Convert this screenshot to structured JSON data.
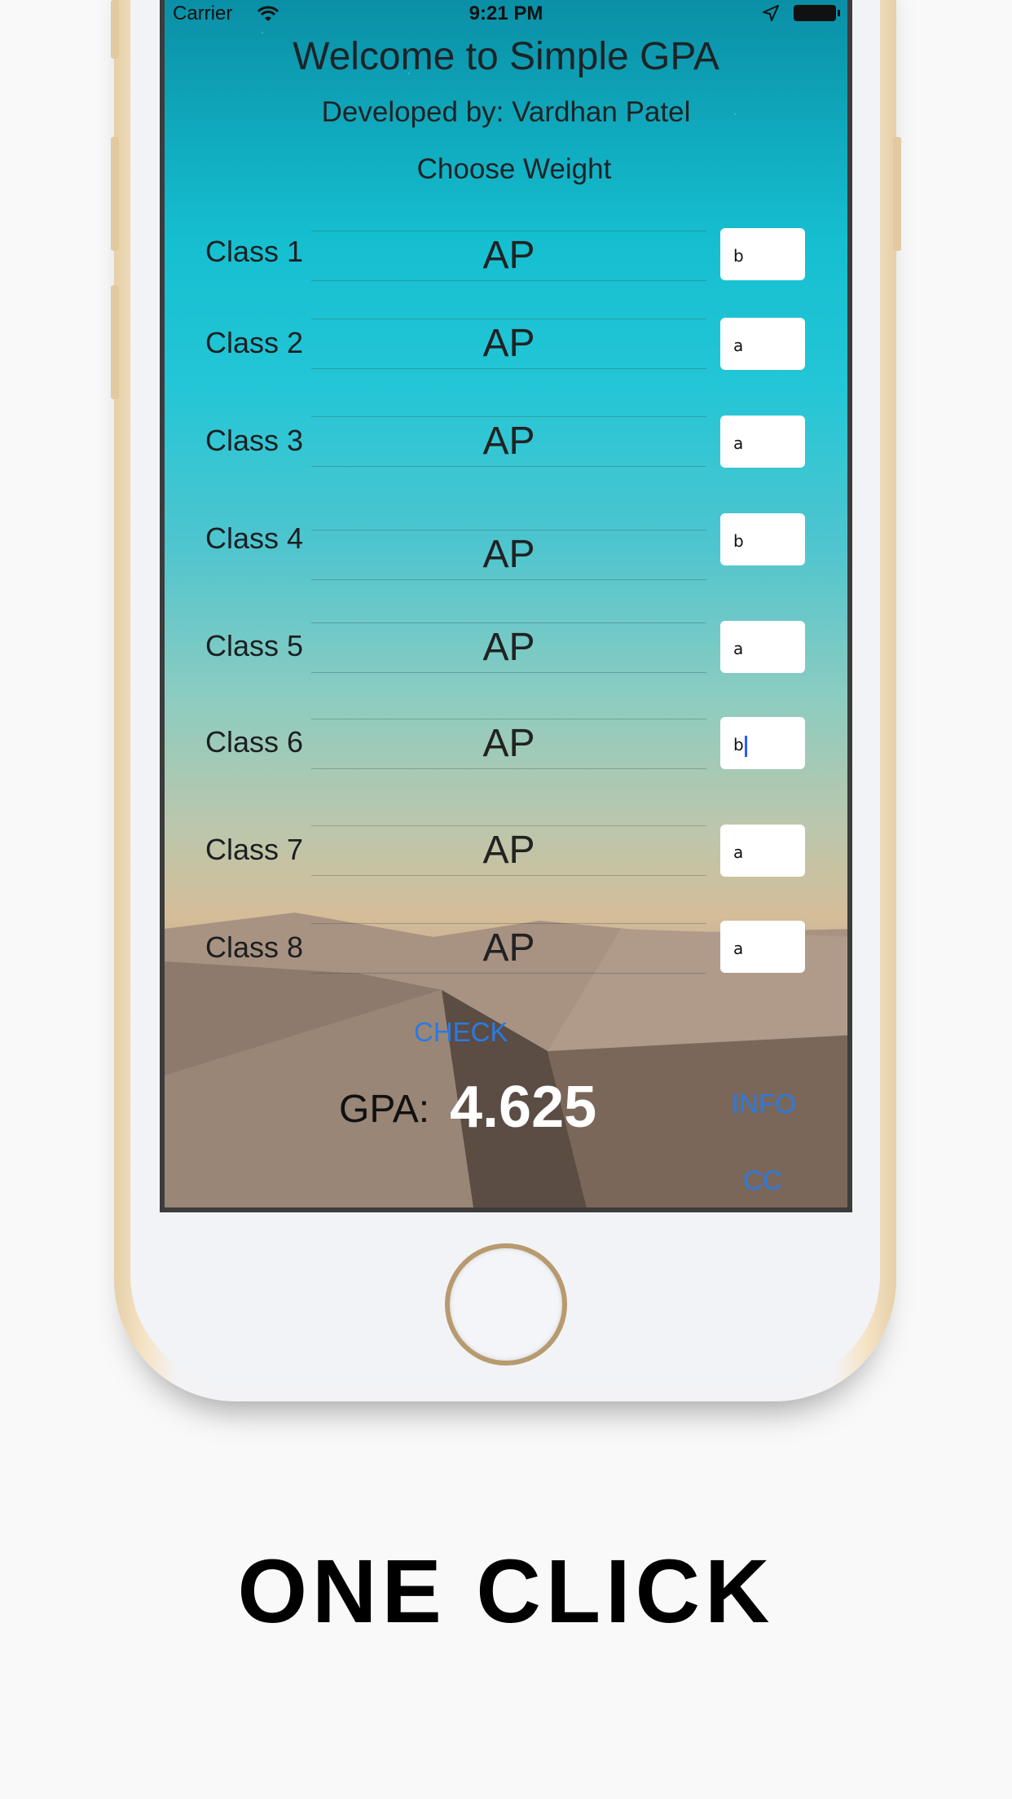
{
  "status_bar": {
    "carrier": "Carrier",
    "time": "9:21 PM"
  },
  "app": {
    "title": "Welcome to Simple GPA",
    "subtitle": "Developed by: Vardhan Patel",
    "weight_prompt": "Choose Weight"
  },
  "classes": [
    {
      "label": "Class 1",
      "weight": "AP",
      "grade": "b"
    },
    {
      "label": "Class 2",
      "weight": "AP",
      "grade": "a"
    },
    {
      "label": "Class 3",
      "weight": "AP",
      "grade": "a"
    },
    {
      "label": "Class 4",
      "weight": "AP",
      "grade": "b"
    },
    {
      "label": "Class 5",
      "weight": "AP",
      "grade": "a"
    },
    {
      "label": "Class 6",
      "weight": "AP",
      "grade": "b"
    },
    {
      "label": "Class 7",
      "weight": "AP",
      "grade": "a"
    },
    {
      "label": "Class 8",
      "weight": "AP",
      "grade": "a"
    }
  ],
  "actions": {
    "check_label": "CHECK",
    "info_label": "INFO",
    "cc_label": "CC"
  },
  "result": {
    "gpa_label": "GPA:",
    "gpa_value": "4.625"
  },
  "caption": "ONE CLICK",
  "colors": {
    "accent": "#2a7ae4",
    "caret": "#2a5cff"
  },
  "icons": [
    "wifi-icon",
    "location-arrow-icon",
    "battery-icon",
    "home-button"
  ]
}
